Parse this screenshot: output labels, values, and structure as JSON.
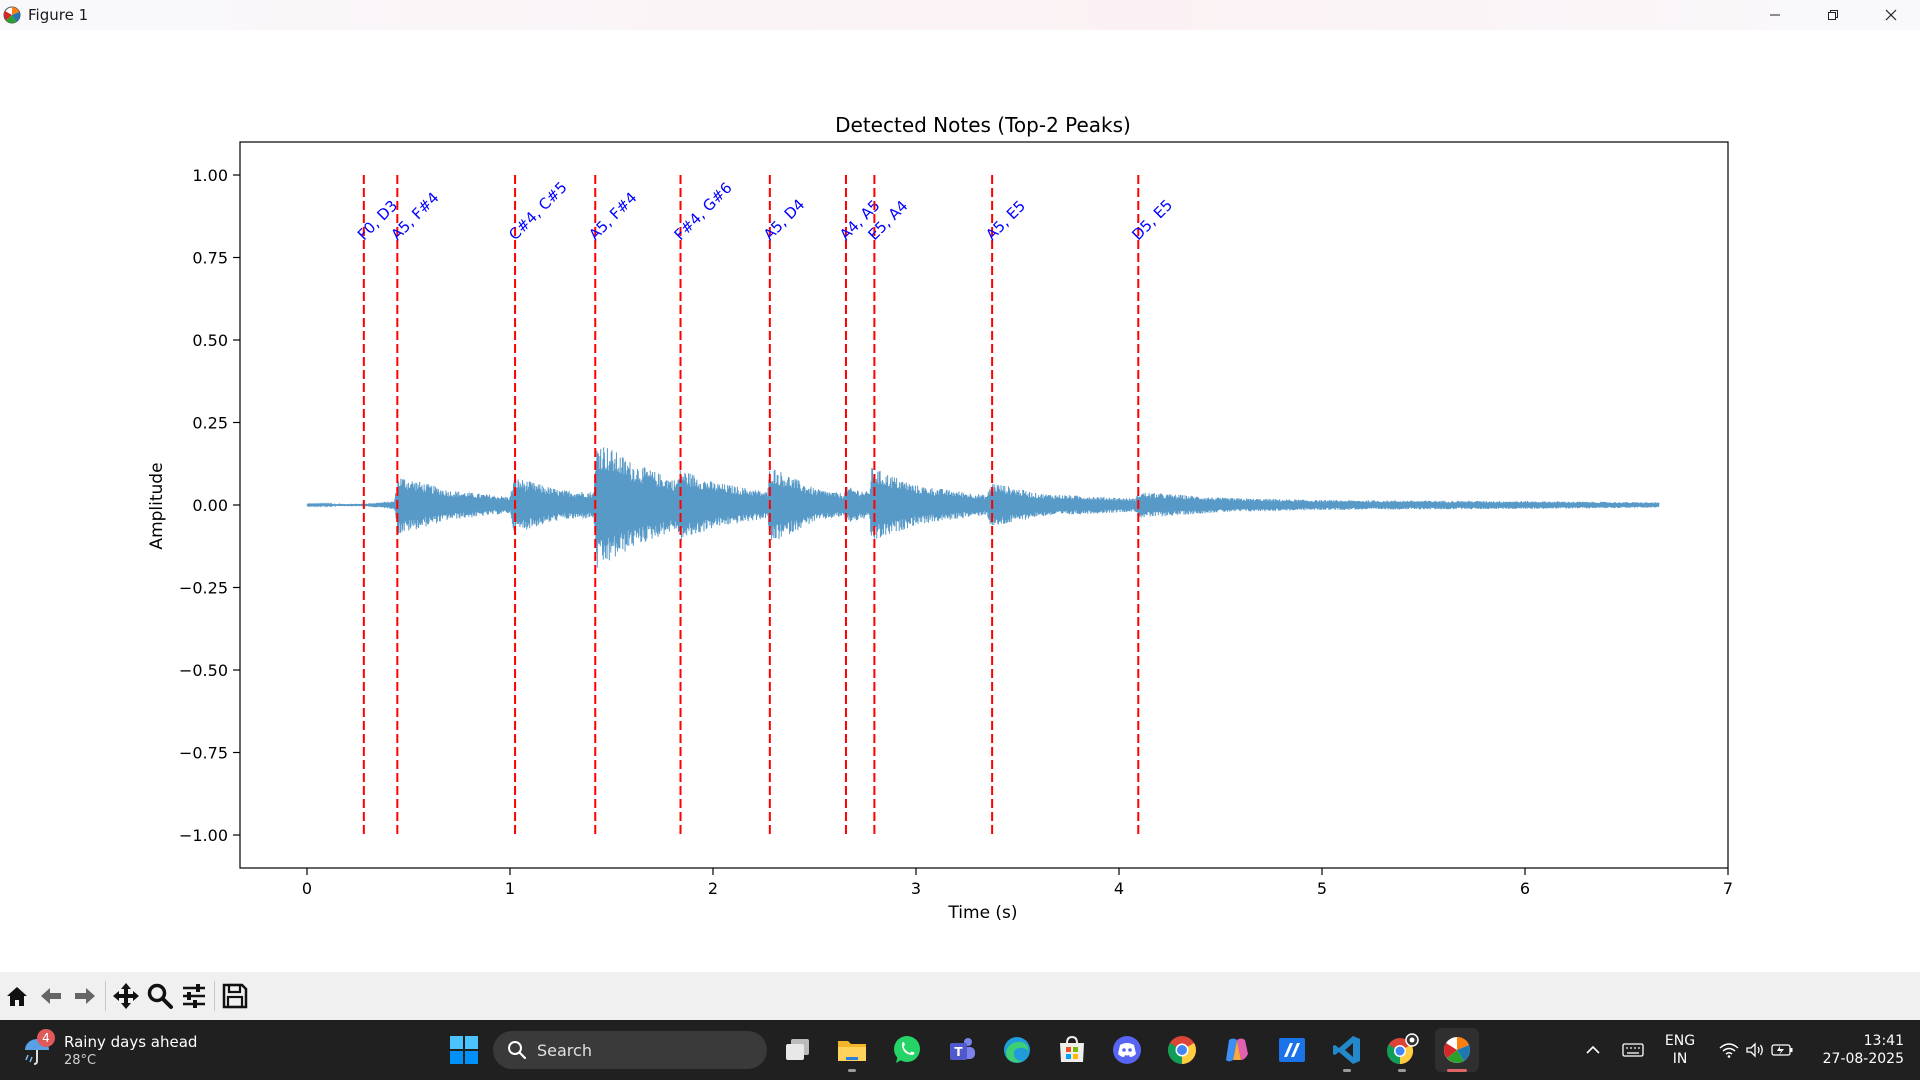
{
  "window": {
    "title": "Figure 1",
    "icons": {
      "app": "matplotlib-icon",
      "minimize": "minimize-icon",
      "maximize": "restore-icon",
      "close": "close-icon"
    }
  },
  "chart_data": {
    "type": "line",
    "title": "Detected Notes (Top-2 Peaks)",
    "xlabel": "Time (s)",
    "ylabel": "Amplitude",
    "xlim": [
      -0.33,
      7
    ],
    "ylim": [
      -1.1,
      1.1
    ],
    "xticks": [
      "0",
      "1",
      "2",
      "3",
      "4",
      "5",
      "6",
      "7"
    ],
    "xtick_values": [
      0,
      1,
      2,
      3,
      4,
      5,
      6,
      7
    ],
    "yticks": [
      "1.00",
      "0.75",
      "0.50",
      "0.25",
      "0.00",
      "−0.25",
      "−0.50",
      "−0.75",
      "−1.00"
    ],
    "ytick_values": [
      1.0,
      0.75,
      0.5,
      0.25,
      0.0,
      -0.25,
      -0.5,
      -0.75,
      -1.0
    ],
    "grid": false,
    "waveform": {
      "color": "#1f77b4",
      "start": 0.0,
      "end": 6.66,
      "envelope": [
        [
          0.0,
          0.002
        ],
        [
          0.28,
          0.004
        ],
        [
          0.43,
          0.012
        ],
        [
          0.45,
          0.09
        ],
        [
          0.7,
          0.045
        ],
        [
          1.0,
          0.025
        ],
        [
          1.02,
          0.085
        ],
        [
          1.25,
          0.045
        ],
        [
          1.41,
          0.04
        ],
        [
          1.43,
          0.2
        ],
        [
          1.6,
          0.13
        ],
        [
          1.82,
          0.075
        ],
        [
          1.84,
          0.11
        ],
        [
          2.0,
          0.07
        ],
        [
          2.27,
          0.04
        ],
        [
          2.28,
          0.12
        ],
        [
          2.5,
          0.05
        ],
        [
          2.64,
          0.035
        ],
        [
          2.66,
          0.055
        ],
        [
          2.77,
          0.04
        ],
        [
          2.78,
          0.115
        ],
        [
          3.0,
          0.06
        ],
        [
          3.35,
          0.03
        ],
        [
          3.37,
          0.07
        ],
        [
          3.6,
          0.035
        ],
        [
          4.08,
          0.02
        ],
        [
          4.1,
          0.04
        ],
        [
          4.5,
          0.022
        ],
        [
          5.0,
          0.015
        ],
        [
          6.0,
          0.012
        ],
        [
          6.66,
          0.008
        ]
      ]
    },
    "onsets": [
      {
        "time": 0.28,
        "label": "F0, D3"
      },
      {
        "time": 0.445,
        "label": "A5, F#4"
      },
      {
        "time": 1.025,
        "label": "C#4, C#5"
      },
      {
        "time": 1.42,
        "label": "A5, F#4"
      },
      {
        "time": 1.84,
        "label": "F#4, G#6"
      },
      {
        "time": 2.28,
        "label": "A5, D4"
      },
      {
        "time": 2.655,
        "label": "A4, A5"
      },
      {
        "time": 2.795,
        "label": "E5, A4"
      },
      {
        "time": 3.375,
        "label": "A5, E5"
      },
      {
        "time": 4.095,
        "label": "D5, E5"
      }
    ],
    "onset_color": "#ff0000",
    "label_color": "#0000ff"
  },
  "toolbar": {
    "icons": [
      "home-icon",
      "back-arrow-icon",
      "forward-arrow-icon",
      "pan-move-icon",
      "zoom-magnifier-icon",
      "configure-subplots-icon",
      "save-floppy-icon"
    ]
  },
  "taskbar": {
    "weather": {
      "badge": "4",
      "line1": "Rainy days ahead",
      "line2": "28°C",
      "icon": "umbrella-rain-icon"
    },
    "search_label": "Search",
    "apps": [
      "task-view-icon",
      "file-explorer-icon",
      "whatsapp-icon",
      "teams-icon",
      "edge-icon",
      "microsoft-store-icon",
      "discord-icon",
      "chrome-icon",
      "copilot-icon",
      "app-icon-blue",
      "vscode-icon",
      "chrome-profile-icon",
      "matplotlib-figure-icon"
    ],
    "tray": {
      "lang1": "ENG",
      "lang2": "IN",
      "time": "13:41",
      "date": "27-08-2025"
    }
  }
}
